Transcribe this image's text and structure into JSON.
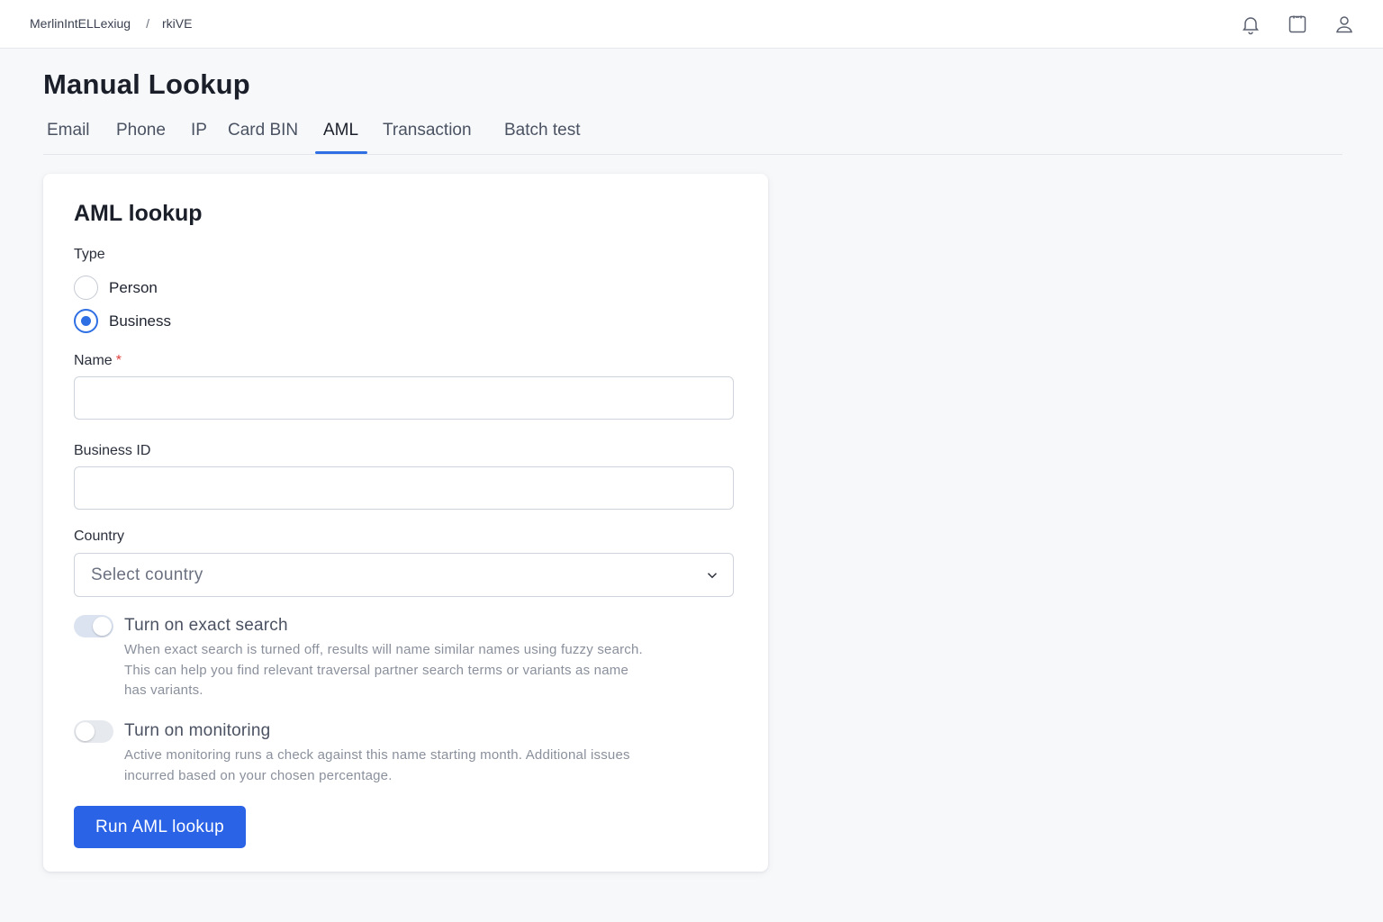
{
  "breadcrumb": {
    "org": "MerlinIntELLexiug",
    "separator": "/",
    "current": "rkiVE"
  },
  "header_icons": [
    "bell-icon",
    "calendar-icon",
    "user-icon"
  ],
  "page": {
    "title": "Manual Lookup"
  },
  "tabs": [
    {
      "label": "Email",
      "active": false
    },
    {
      "label": "Phone",
      "active": false
    },
    {
      "label": "IP",
      "active": false
    },
    {
      "label": "Card BIN",
      "active": false
    },
    {
      "label": "AML",
      "active": true
    },
    {
      "label": "Transaction",
      "active": false
    },
    {
      "label": "Batch test",
      "active": false
    }
  ],
  "card": {
    "title": "AML lookup",
    "type_label": "Type",
    "type_options": [
      {
        "label": "Person",
        "checked": false
      },
      {
        "label": "Business",
        "checked": true
      }
    ],
    "name_label": "Name",
    "name_required": "*",
    "name_value": "",
    "business_id_label": "Business ID",
    "business_id_value": "",
    "country_label": "Country",
    "country_placeholder": "Select country",
    "exact_search": {
      "title": "Turn on exact search",
      "enabled": true,
      "desc_lines": [
        "When exact search is turned off, results will name similar names using fuzzy search.",
        "This can help you find relevant traversal partner search terms or variants as name",
        "has variants."
      ]
    },
    "monitoring": {
      "title": "Turn on monitoring",
      "enabled": false,
      "desc_lines": [
        "Active monitoring runs a check against this name starting month. Additional issues",
        "incurred based on your chosen percentage."
      ]
    },
    "submit_label": "Run AML lookup"
  },
  "colors": {
    "accent": "#2f6fe4",
    "button": "#2b63e6",
    "required": "#e04040"
  }
}
